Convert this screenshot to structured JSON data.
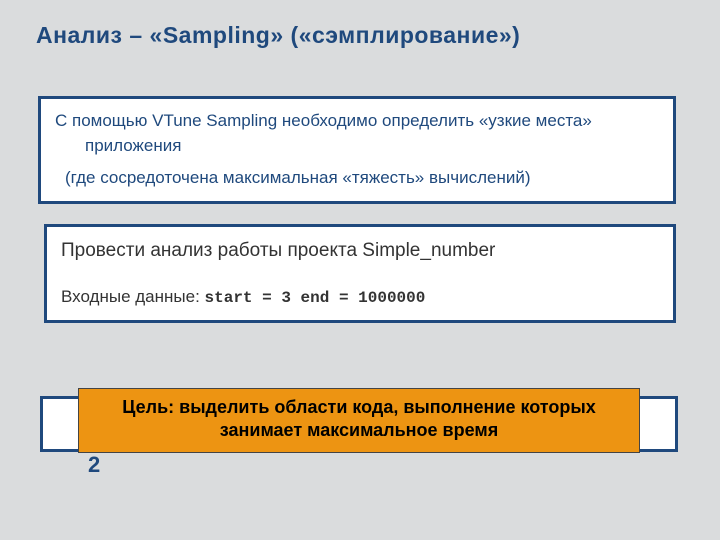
{
  "title": "Анализ – «Sampling» («сэмплирование»)",
  "box1": {
    "line1": "С помощью  VTune Sampling необходимо определить «узкие места» приложения",
    "line2": "(где сосредоточена максимальная «тяжесть» вычислений)"
  },
  "box2": {
    "line1": "Провести анализ работы проекта Simple_number",
    "line2_label": "Входные данные: ",
    "line2_code": "start = 3  end = 1000000"
  },
  "goal": "Цель: выделить области кода, выполнение которых занимает максимальное время",
  "pagenum": "2"
}
